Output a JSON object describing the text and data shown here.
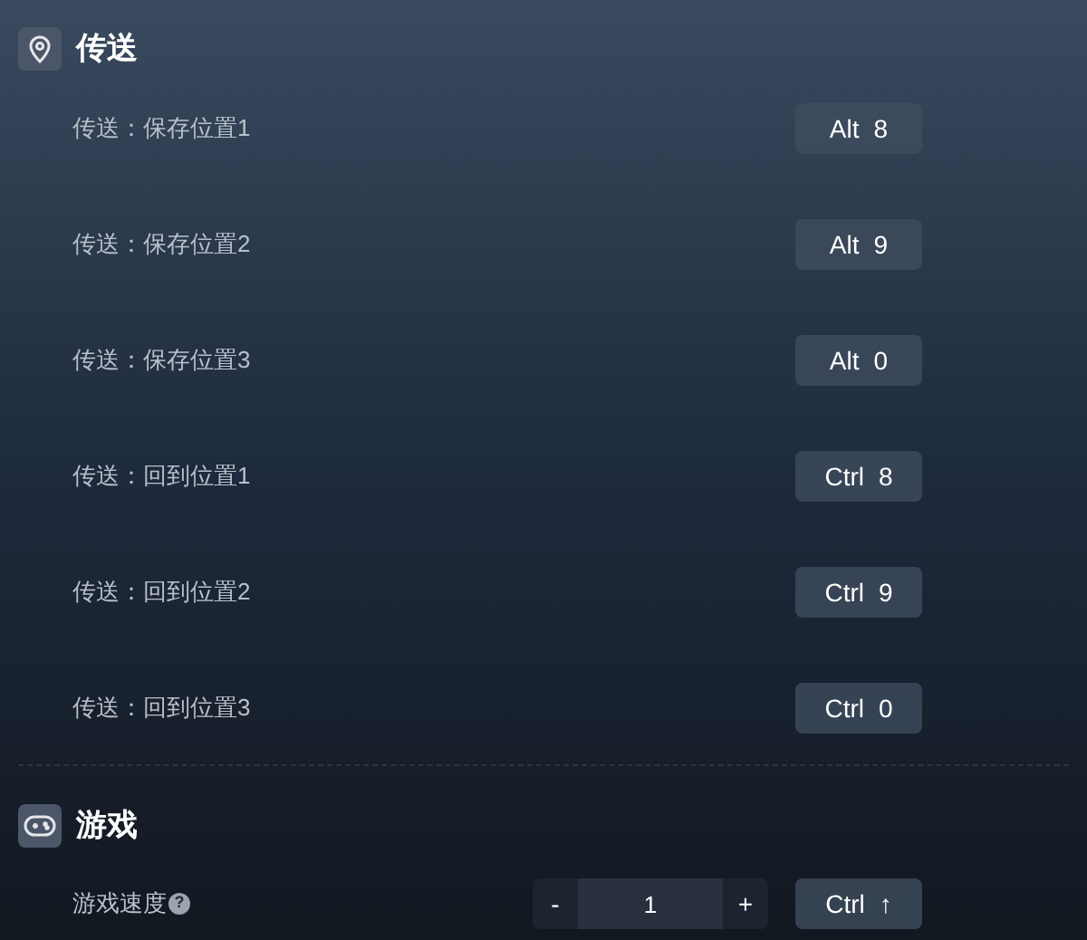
{
  "sections": [
    {
      "kind": "teleport",
      "title": "传送",
      "rows": [
        {
          "kind": "hotkey",
          "label": "传送：保存位置1",
          "keys": [
            "Alt",
            "8"
          ]
        },
        {
          "kind": "hotkey",
          "label": "传送：保存位置2",
          "keys": [
            "Alt",
            "9"
          ]
        },
        {
          "kind": "hotkey",
          "label": "传送：保存位置3",
          "keys": [
            "Alt",
            "0"
          ]
        },
        {
          "kind": "hotkey",
          "label": "传送：回到位置1",
          "keys": [
            "Ctrl",
            "8"
          ]
        },
        {
          "kind": "hotkey",
          "label": "传送：回到位置2",
          "keys": [
            "Ctrl",
            "9"
          ]
        },
        {
          "kind": "hotkey",
          "label": "传送：回到位置3",
          "keys": [
            "Ctrl",
            "0"
          ]
        }
      ]
    },
    {
      "kind": "game",
      "title": "游戏",
      "rows": [
        {
          "kind": "stepper",
          "label": "游戏速度",
          "help": "?",
          "minus": "-",
          "value": "1",
          "plus": "+",
          "keys": [
            "Ctrl",
            "↑"
          ]
        }
      ]
    }
  ]
}
